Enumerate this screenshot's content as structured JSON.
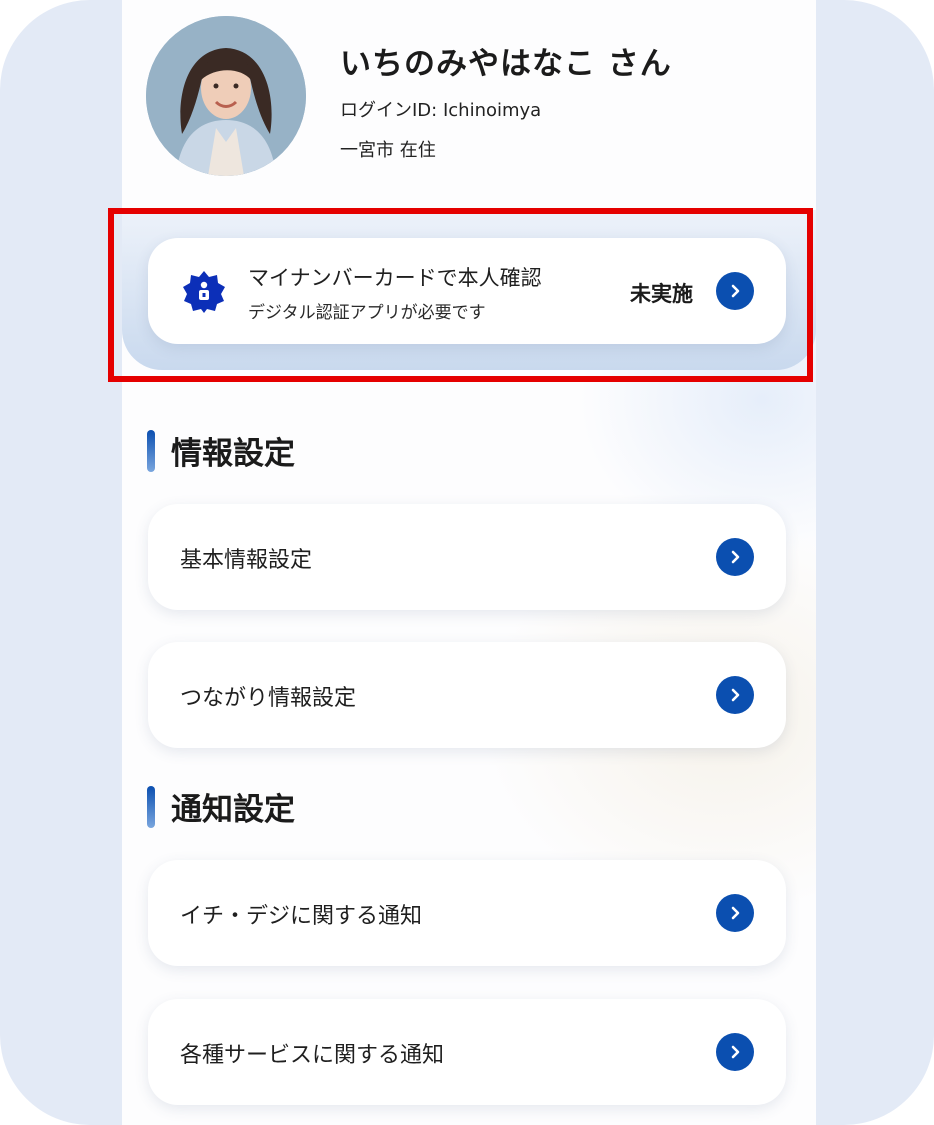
{
  "profile": {
    "name": "いちのみやはなこ さん",
    "login_id": "ログインID: Ichinoimya",
    "residence": "一宮市 在住"
  },
  "verification": {
    "title": "マイナンバーカードで本人確認",
    "subtitle": "デジタル認証アプリが必要です",
    "status": "未実施",
    "highlight_color": "#e50000"
  },
  "sections": [
    {
      "title": "情報設定",
      "items": [
        {
          "label": "基本情報設定"
        },
        {
          "label": "つながり情報設定"
        }
      ]
    },
    {
      "title": "通知設定",
      "items": [
        {
          "label": "イチ・デジに関する通知"
        },
        {
          "label": "各種サービスに関する通知"
        }
      ]
    }
  ],
  "icons": {
    "verify": "shield-badge-icon",
    "chevron": "chevron-right-icon"
  },
  "colors": {
    "accent": "#0b4fb0",
    "background": "#e3eaf6"
  }
}
